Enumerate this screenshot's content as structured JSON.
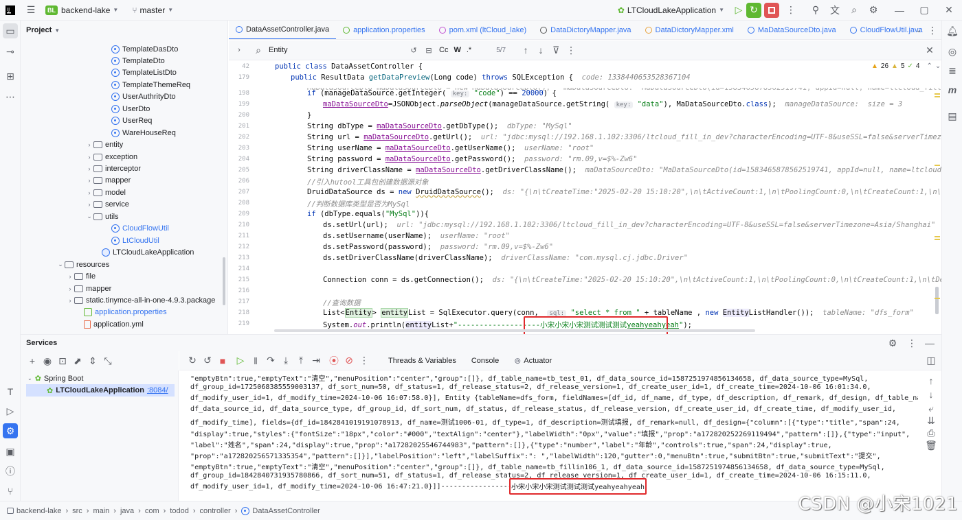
{
  "titlebar": {
    "project_badge": "BL",
    "project_name": "backend-lake",
    "branch": "master",
    "run_config": "LTCloudLakeApplication"
  },
  "project_panel": {
    "title": "Project",
    "items": [
      {
        "label": "TemplateDasDto",
        "kind": "class"
      },
      {
        "label": "TemplateDto",
        "kind": "class"
      },
      {
        "label": "TemplateListDto",
        "kind": "class"
      },
      {
        "label": "TemplateThemeReq",
        "kind": "class"
      },
      {
        "label": "UserAuthrityDto",
        "kind": "class"
      },
      {
        "label": "UserDto",
        "kind": "class"
      },
      {
        "label": "UserReq",
        "kind": "class"
      },
      {
        "label": "WareHouseReq",
        "kind": "class"
      },
      {
        "label": "entity",
        "kind": "folder"
      },
      {
        "label": "exception",
        "kind": "folder"
      },
      {
        "label": "interceptor",
        "kind": "folder"
      },
      {
        "label": "mapper",
        "kind": "folder"
      },
      {
        "label": "model",
        "kind": "folder"
      },
      {
        "label": "service",
        "kind": "folder"
      },
      {
        "label": "utils",
        "kind": "folder-open"
      },
      {
        "label": "CloudFlowUtil",
        "kind": "class-blue"
      },
      {
        "label": "LtCloudUtil",
        "kind": "class-blue"
      },
      {
        "label": "LTCloudLakeApplication",
        "kind": "app"
      },
      {
        "label": "resources",
        "kind": "folder-open"
      },
      {
        "label": "file",
        "kind": "folder"
      },
      {
        "label": "mapper",
        "kind": "folder"
      },
      {
        "label": "static.tinymce-all-in-one-4.9.3.package",
        "kind": "folder"
      },
      {
        "label": "application.properties",
        "kind": "prop"
      },
      {
        "label": "application.yml",
        "kind": "yml"
      }
    ]
  },
  "tabs": [
    {
      "label": "DataAssetController.java",
      "active": true
    },
    {
      "label": "application.properties",
      "active": false
    },
    {
      "label": "pom.xml (ltCloud_lake)",
      "active": false
    },
    {
      "label": "DataDictoryMapper.java",
      "active": false
    },
    {
      "label": "DataDictoryMapper.xml",
      "active": false
    },
    {
      "label": "MaDataSourceDto.java",
      "active": false
    },
    {
      "label": "CloudFlowUtil.java",
      "active": false
    }
  ],
  "findbar": {
    "query": "Entity",
    "options": [
      "Cc",
      "W",
      ".*"
    ],
    "count": "5/7"
  },
  "inspections": {
    "warnings": "26",
    "weak": "5",
    "ok": "4"
  },
  "editor": {
    "line_numbers": [
      "42",
      "179",
      "198",
      "199",
      "200",
      "201",
      "202",
      "203",
      "204",
      "205",
      "206",
      "207",
      "208",
      "209",
      "210",
      "211",
      "212",
      "213",
      "214",
      "215",
      "216",
      "217",
      "218",
      "219"
    ]
  },
  "services": {
    "title": "Services",
    "tree_root": "Spring Boot",
    "app": "LTCloudLakeApplication",
    "port": ":8084/",
    "tabs": [
      "Threads & Variables",
      "Console",
      "Actuator"
    ]
  },
  "console_lines": [
    "\"emptyBtn\":true,\"emptyText\":\"清空\",\"menuPosition\":\"center\",\"group\":[]}, df_table_name=tb_test_01, df_data_source_id=1587251974856134658, df_data_source_type=MySql,",
    "df_group_id=1725068385559003137, df_sort_num=50, df_status=1, df_release_status=2, df_release_version=1, df_create_user_id=1, df_create_time=2024-10-06 16:01:34.0,",
    "df_modify_user_id=1, df_modify_time=2024-10-06 16:07:58.0}], Entity {tableName=dfs_form, fieldNames=[df_id, df_name, df_type, df_description, df_remark, df_design, df_table_name,",
    "df_data_source_id, df_data_source_type, df_group_id, df_sort_num, df_status, df_release_status, df_release_version, df_create_user_id, df_create_time, df_modify_user_id,",
    "df_modify_time], fields={df_id=1842841019191078913, df_name=测试1006-01, df_type=1, df_description=测试填报, df_remark=null, df_design={\"column\":[{\"type\":\"title\",\"span\":24,",
    "\"display\":true,\"styles\":{\"fontSize\":\"18px\",\"color\":\"#000\",\"textAlign\":\"center\"},\"labelWidth\":\"0px\",\"value\":\"填报\",\"prop\":\"a172820252269119494\",\"pattern\":[]},{\"type\":\"input\",",
    "\"label\":\"姓名\",\"span\":24,\"display\":true,\"prop\":\"a17282025546744983\",\"pattern\":[]},{\"type\":\"number\",\"label\":\"年龄\",\"controls\":true,\"span\":24,\"display\":true,",
    "\"prop\":\"a172820256571335354\",\"pattern\":[]}],\"labelPosition\":\"left\",\"labelSuffix\":\": \",\"labelWidth\":120,\"gutter\":0,\"menuBtn\":true,\"submitBtn\":true,\"submitText\":\"提交\",",
    "\"emptyBtn\":true,\"emptyText\":\"清空\",\"menuPosition\":\"center\",\"group\":[]}, df_table_name=tb_fillin106_1, df_data_source_id=1587251974856134658, df_data_source_type=MySql,",
    "df_group_id=1842840731935780866, df_sort_num=51, df_status=1, df_release_status=2, df_release_version=1, df_create_user_id=1, df_create_time=2024-10-06 16:15:11.0,",
    "df_modify_user_id=1, df_modify_time=2024-10-06 16:47:21.0}]]--------------------"
  ],
  "console_highlight": "小宋小宋小宋测试测试测试yeahyeahyeah",
  "breadcrumb": [
    "backend-lake",
    "src",
    "main",
    "java",
    "com",
    "todod",
    "controller",
    "DataAssetController"
  ],
  "watermark": "CSDN @小宋1021"
}
